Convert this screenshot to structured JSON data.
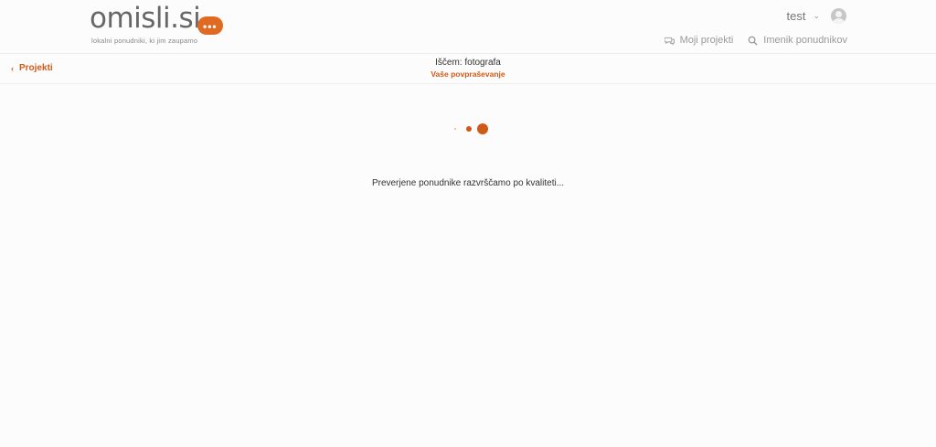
{
  "brand": {
    "name": "omisli.si",
    "tagline": "lokalni ponudniki, ki jim zaupamo",
    "accent": "#e06a22"
  },
  "user": {
    "name": "test"
  },
  "nav": {
    "items": [
      {
        "label": "Moji projekti",
        "icon": "chat-bubbles-icon"
      },
      {
        "label": "Imenik ponudnikov",
        "icon": "search-icon"
      }
    ]
  },
  "subbar": {
    "back_label": "Projekti",
    "title": "Iščem: fotografa",
    "subtitle": "Vaše povpraševanje"
  },
  "main": {
    "message": "Preverjene ponudnike razvrščamo po kvaliteti..."
  }
}
